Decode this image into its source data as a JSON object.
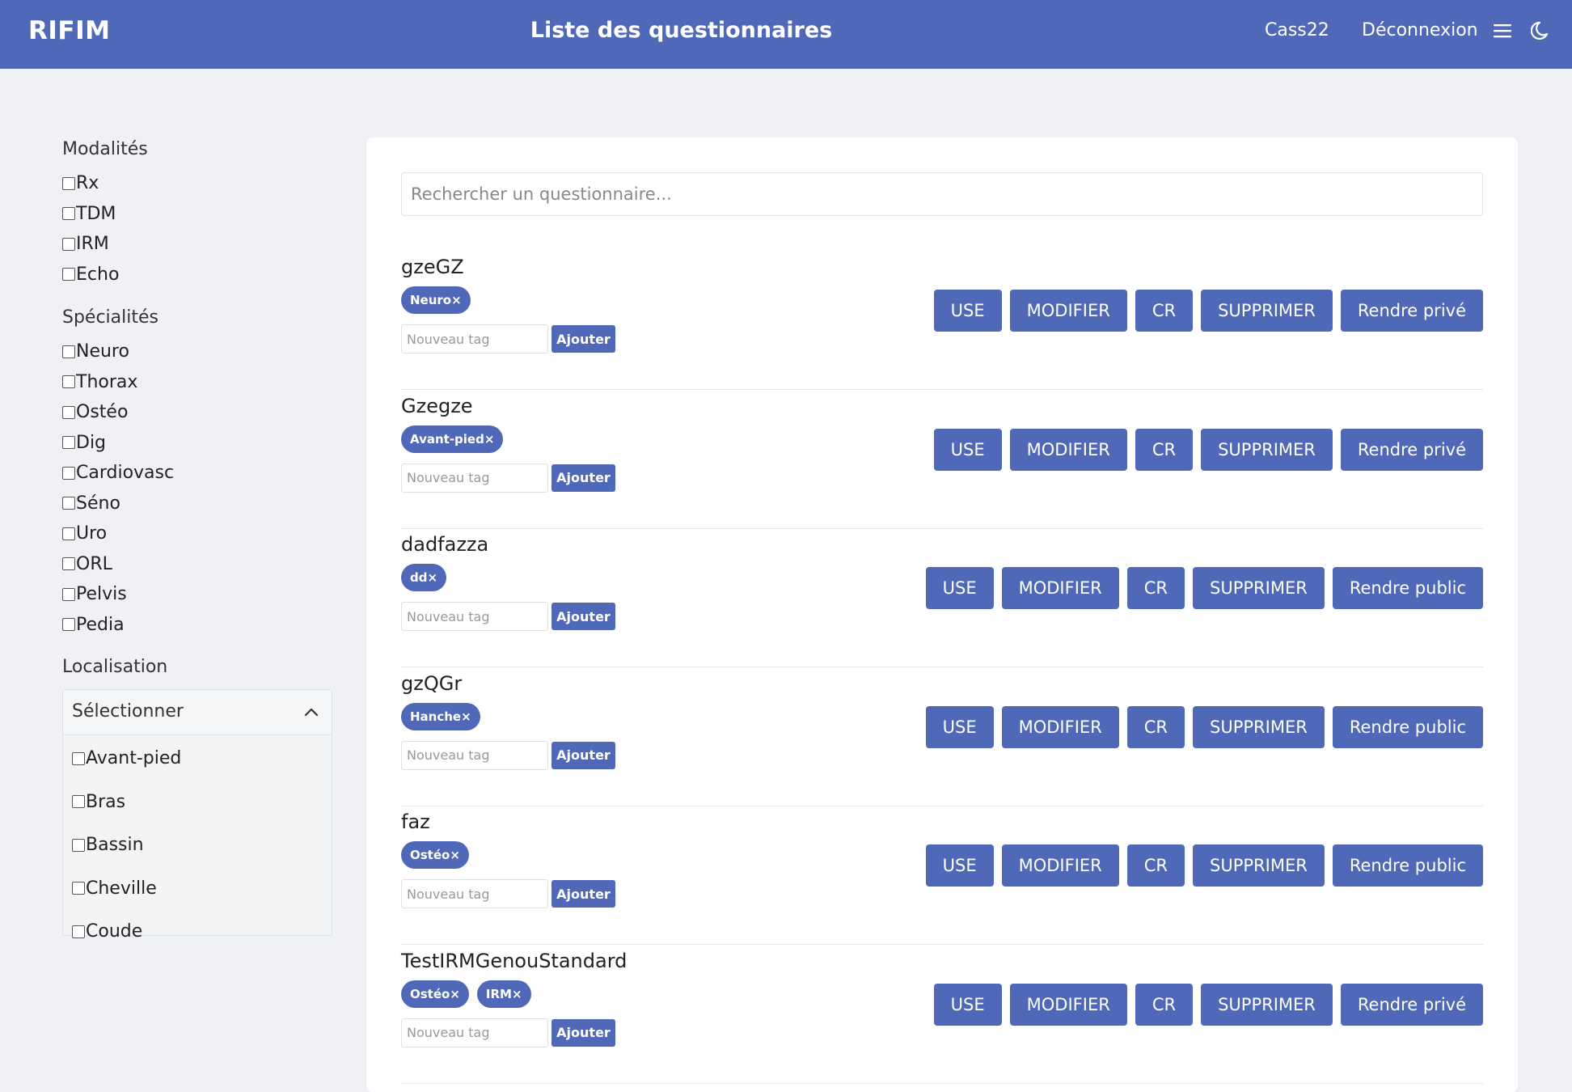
{
  "header": {
    "brand": "RIFIM",
    "title": "Liste des questionnaires",
    "user": "Cass22",
    "logout": "Déconnexion",
    "menu_icon": "hamburger-menu-icon",
    "theme_icon": "moon-icon"
  },
  "sidebar": {
    "modalites_title": "Modalités",
    "modalites": [
      "Rx",
      "TDM",
      "IRM",
      "Echo"
    ],
    "specialites_title": "Spécialités",
    "specialites": [
      "Neuro",
      "Thorax",
      "Ostéo",
      "Dig",
      "Cardiovasc",
      "Séno",
      "Uro",
      "ORL",
      "Pelvis",
      "Pedia"
    ],
    "localisation_title": "Localisation",
    "select_label": "Sélectionner",
    "localisations": [
      "Avant-pied",
      "Bras",
      "Bassin",
      "Cheville",
      "Coude"
    ]
  },
  "search": {
    "placeholder": "Rechercher un questionnaire..."
  },
  "actions": {
    "use": "USE",
    "modifier": "MODIFIER",
    "cr": "CR",
    "supprimer": "SUPPRIMER",
    "tag_placeholder": "Nouveau tag",
    "add": "Ajouter"
  },
  "questionnaires": [
    {
      "name": "gzeGZ",
      "tags": [
        "Neuro×"
      ],
      "visibility_action": "Rendre privé"
    },
    {
      "name": "Gzegze",
      "tags": [
        "Avant-pied×"
      ],
      "visibility_action": "Rendre privé"
    },
    {
      "name": "dadfazza",
      "tags": [
        "dd×"
      ],
      "visibility_action": "Rendre public"
    },
    {
      "name": "gzQGr",
      "tags": [
        "Hanche×"
      ],
      "visibility_action": "Rendre public"
    },
    {
      "name": "faz",
      "tags": [
        "Ostéo×"
      ],
      "visibility_action": "Rendre public"
    },
    {
      "name": "TestIRMGenouStandard",
      "tags": [
        "Ostéo×",
        "IRM×"
      ],
      "visibility_action": "Rendre privé"
    }
  ],
  "colors": {
    "primary": "#5068b8",
    "background": "#f0f1f4",
    "card": "#ffffff"
  }
}
